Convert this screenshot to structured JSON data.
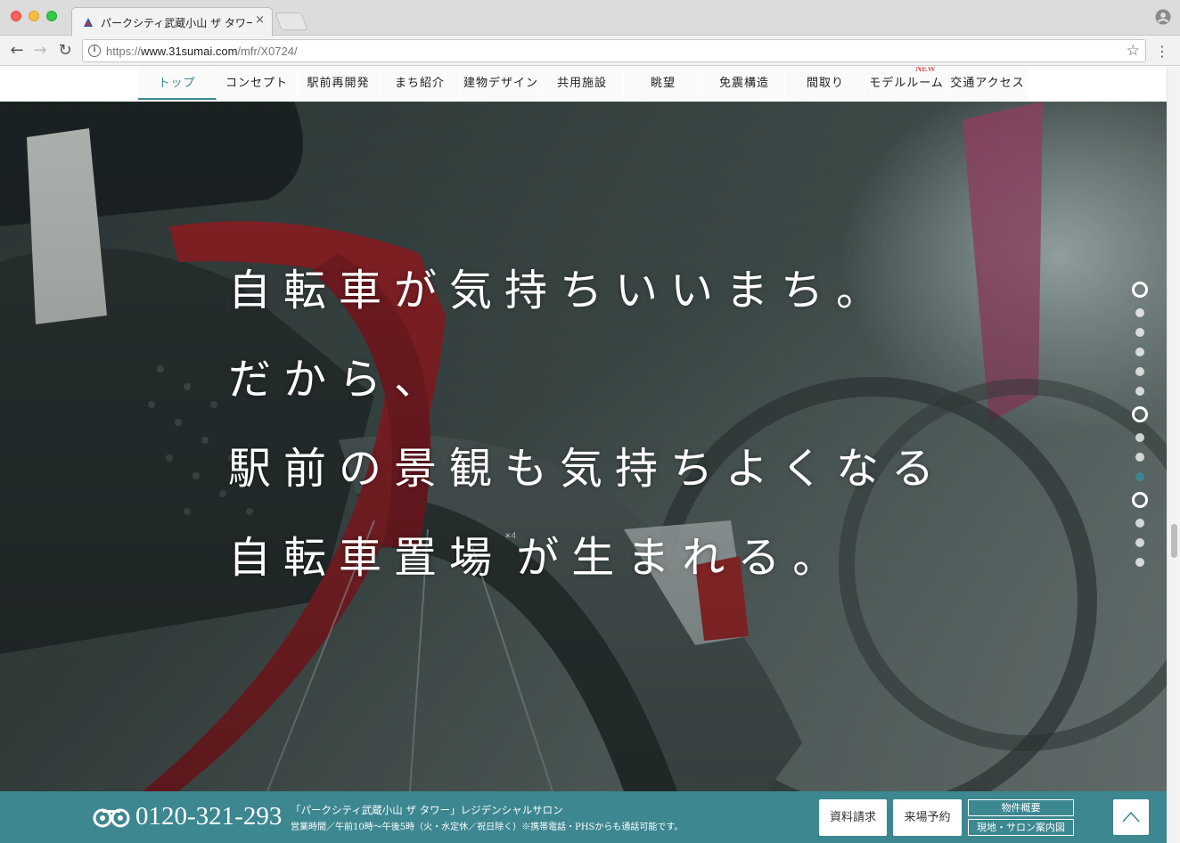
{
  "browser": {
    "tab_title": "パークシティ武蔵小山 ザ タワー",
    "tab_close": "×",
    "url_prefix": "https://",
    "url_host": "www.31sumai.com",
    "url_path": "/mfr/X0724/",
    "back": "←",
    "forward": "→",
    "reload": "↻",
    "info": "i",
    "star": "☆",
    "menu": "⋮"
  },
  "nav": {
    "items": [
      {
        "label": "トップ"
      },
      {
        "label": "コンセプト"
      },
      {
        "label": "駅前再開発"
      },
      {
        "label": "まち紹介"
      },
      {
        "label": "建物デザイン"
      },
      {
        "label": "共用施設"
      },
      {
        "label": "眺望"
      },
      {
        "label": "免震構造"
      },
      {
        "label": "間取り"
      },
      {
        "label": "モデルルーム"
      },
      {
        "label": "交通アクセス"
      }
    ],
    "new_badge": "NEW",
    "accent": "#3d8791"
  },
  "hero": {
    "line1": "自転車が気持ちいいまち。",
    "line2": "だから、",
    "line3": "駅前の景観も気持ちよくなる",
    "line4a": "自転車置場",
    "footnote": "※4",
    "line4b": "が生まれる。",
    "slide_count": 15,
    "current_slide": 10
  },
  "footer": {
    "tel": "0120-321-293",
    "salon_name": "「パークシティ武蔵小山 ザ タワー」レジデンシャルサロン",
    "hours": "営業時間／午前10時〜午後5時（火・水定休／祝日除く）※携帯電話・PHSからも通話可能です。",
    "request_button": "資料請求",
    "visit_button": "来場予約",
    "overview_link": "物件概要",
    "map_link": "現地・サロン案内図",
    "back_to_top": "^",
    "bg_color": "#3d8791"
  }
}
